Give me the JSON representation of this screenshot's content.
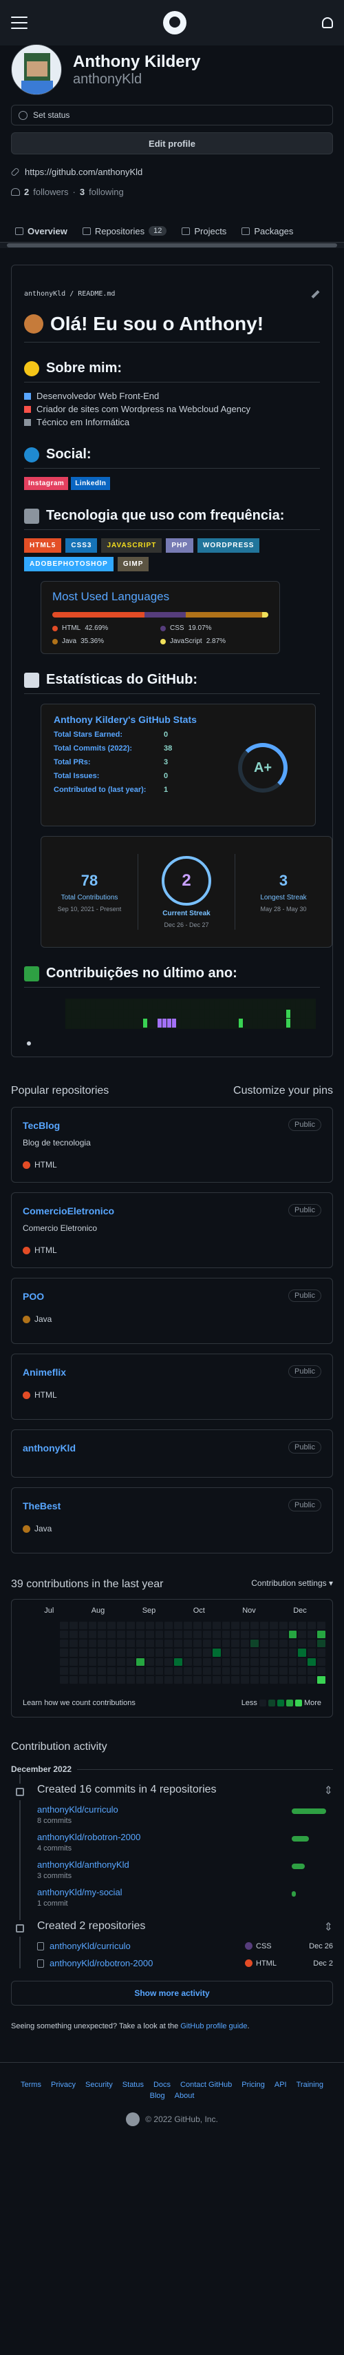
{
  "header": {
    "menu_icon": "menu-icon",
    "logo_icon": "github-logo-icon",
    "bell_icon": "bell-icon"
  },
  "profile": {
    "name": "Anthony Kildery",
    "login": "anthonyKld",
    "status": "Set status",
    "edit": "Edit profile",
    "url": "https://github.com/anthonyKld",
    "followers": "2",
    "followers_label": "followers",
    "following": "3",
    "following_label": "following"
  },
  "tabs": [
    {
      "label": "Overview"
    },
    {
      "label": "Repositories",
      "count": "12"
    },
    {
      "label": "Projects"
    },
    {
      "label": "Packages"
    }
  ],
  "readme": {
    "path": "anthonyKld / README.md",
    "title": "Olá! Eu sou o Anthony!",
    "about_h": "Sobre mim:",
    "about": [
      "Desenvolvedor Web Front-End",
      "Criador de sites com Wordpress na Webcloud Agency",
      "Técnico em Informática"
    ],
    "social_h": "Social:",
    "social": [
      "Instagram",
      "LinkedIn"
    ],
    "tech_h": "Tecnologia que uso com frequência:",
    "tech": [
      "HTML5",
      "CSS3",
      "JAVASCRIPT",
      "PHP",
      "WORDPRESS",
      "ADOBEPHOTOSHOP",
      "GIMP"
    ],
    "stats_h": "Estatísticas do GitHub:",
    "contrib_h": "Contribuições no último ano:"
  },
  "languages": {
    "title": "Most Used Languages",
    "items": [
      {
        "name": "HTML",
        "pct": "42.69%",
        "value": 42.69,
        "color": "#e34c26"
      },
      {
        "name": "CSS",
        "pct": "19.07%",
        "value": 19.07,
        "color": "#563d7c"
      },
      {
        "name": "Java",
        "pct": "35.36%",
        "value": 35.36,
        "color": "#b07219"
      },
      {
        "name": "JavaScript",
        "pct": "2.87%",
        "value": 2.87,
        "color": "#f1e05a"
      }
    ]
  },
  "stats": {
    "title": "Anthony Kildery's GitHub Stats",
    "rows": [
      {
        "label": "Total Stars Earned:",
        "value": "0"
      },
      {
        "label": "Total Commits (2022):",
        "value": "38"
      },
      {
        "label": "Total PRs:",
        "value": "3"
      },
      {
        "label": "Total Issues:",
        "value": "0"
      },
      {
        "label": "Contributed to (last year):",
        "value": "1"
      }
    ],
    "grade": "A+"
  },
  "streak": {
    "total": "78",
    "total_label": "Total Contributions",
    "total_range": "Sep 10, 2021 - Present",
    "current": "2",
    "current_label": "Current Streak",
    "current_range": "Dec 26 - Dec 27",
    "longest": "3",
    "longest_label": "Longest Streak",
    "longest_range": "May 28 - May 30"
  },
  "popular": {
    "title": "Popular repositories",
    "customize": "Customize your pins",
    "repos": [
      {
        "name": "TecBlog",
        "badge": "Public",
        "desc": "Blog de tecnologia",
        "lang": "HTML",
        "color": "#e34c26"
      },
      {
        "name": "ComercioEletronico",
        "badge": "Public",
        "desc": "Comercio Eletronico",
        "lang": "HTML",
        "color": "#e34c26"
      },
      {
        "name": "POO",
        "badge": "Public",
        "desc": "",
        "lang": "Java",
        "color": "#b07219"
      },
      {
        "name": "Animeflix",
        "badge": "Public",
        "desc": "",
        "lang": "HTML",
        "color": "#e34c26"
      },
      {
        "name": "anthonyKld",
        "badge": "Public",
        "desc": "",
        "lang": "",
        "color": ""
      },
      {
        "name": "TheBest",
        "badge": "Public",
        "desc": "",
        "lang": "Java",
        "color": "#b07219"
      }
    ]
  },
  "contributions": {
    "title": "39 contributions in the last year",
    "settings": "Contribution settings ▾",
    "months": [
      "Jul",
      "Aug",
      "Sep",
      "Oct",
      "Nov",
      "Dec"
    ],
    "learn": "Learn how we count contributions",
    "less": "Less",
    "more": "More"
  },
  "activity": {
    "title": "Contribution activity",
    "month": "December 2022",
    "commits_title": "Created 16 commits in 4 repositories",
    "commits": [
      {
        "repo": "anthonyKld/curriculo",
        "count": "8 commits",
        "value": 8
      },
      {
        "repo": "anthonyKld/robotron-2000",
        "count": "4 commits",
        "value": 4
      },
      {
        "repo": "anthonyKld/anthonyKld",
        "count": "3 commits",
        "value": 3
      },
      {
        "repo": "anthonyKld/my-social",
        "count": "1 commit",
        "value": 1
      }
    ],
    "repos_title": "Created 2 repositories",
    "repos": [
      {
        "repo": "anthonyKld/curriculo",
        "lang": "CSS",
        "color": "#563d7c",
        "date": "Dec 26"
      },
      {
        "repo": "anthonyKld/robotron-2000",
        "lang": "HTML",
        "color": "#e34c26",
        "date": "Dec 2"
      }
    ],
    "more": "Show more activity"
  },
  "unexpected": {
    "text": "Seeing something unexpected? Take a look at the ",
    "link": "GitHub profile guide",
    "end": "."
  },
  "footer": {
    "links": [
      "Terms",
      "Privacy",
      "Security",
      "Status",
      "Docs",
      "Contact GitHub",
      "Pricing",
      "API",
      "Training",
      "Blog",
      "About"
    ],
    "copy": "© 2022 GitHub, Inc."
  }
}
